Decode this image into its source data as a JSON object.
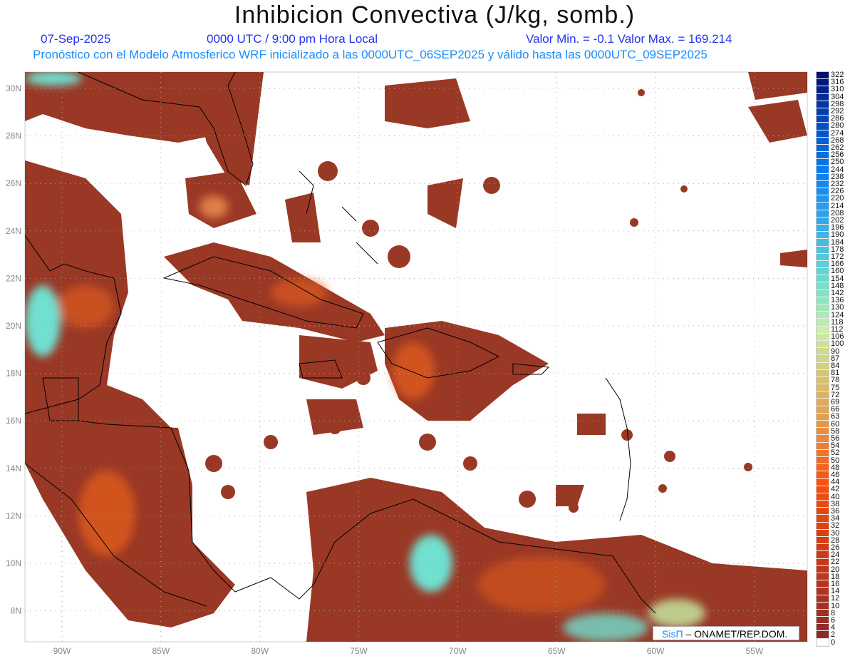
{
  "header": {
    "title": "Inhibicion Convectiva (J/kg, somb.)",
    "date": "07-Sep-2025",
    "time": "0000 UTC / 9:00 pm Hora Local",
    "minmax": "Valor Min. = -0.1  Valor Max. = 169.214",
    "forecast": "Pronóstico con el Modelo Atmosferico WRF inicializado a las 0000UTC_06SEP2025 y válido hasta las  0000UTC_09SEP2025"
  },
  "axes": {
    "lon_labels": [
      "90W",
      "85W",
      "80W",
      "75W",
      "70W",
      "65W",
      "60W",
      "55W"
    ],
    "lat_labels": [
      "30N",
      "28N",
      "26N",
      "24N",
      "22N",
      "20N",
      "18N",
      "16N",
      "14N",
      "12N",
      "10N",
      "8N"
    ]
  },
  "colorbar": {
    "labels": [
      "322",
      "316",
      "310",
      "304",
      "298",
      "292",
      "286",
      "280",
      "274",
      "268",
      "262",
      "256",
      "250",
      "244",
      "238",
      "232",
      "226",
      "220",
      "214",
      "208",
      "202",
      "196",
      "190",
      "184",
      "178",
      "172",
      "166",
      "160",
      "154",
      "148",
      "142",
      "136",
      "130",
      "124",
      "118",
      "112",
      "106",
      "100",
      "90",
      "87",
      "84",
      "81",
      "78",
      "75",
      "72",
      "69",
      "66",
      "63",
      "60",
      "58",
      "56",
      "54",
      "52",
      "50",
      "48",
      "46",
      "44",
      "42",
      "40",
      "38",
      "36",
      "34",
      "32",
      "30",
      "28",
      "26",
      "24",
      "22",
      "20",
      "18",
      "16",
      "14",
      "12",
      "10",
      "8",
      "6",
      "4",
      "2",
      "0"
    ],
    "stops": [
      "#001070",
      "#0050c8",
      "#0a84f5",
      "#3aaee6",
      "#66dcd0",
      "#c8f0a8",
      "#d8c070",
      "#e89040",
      "#f85010",
      "#d84010",
      "#b83420",
      "#8c2a28",
      "#ffffff"
    ]
  },
  "logo": {
    "brand": "SisΠ",
    "text": " – ONAMET/REP.DOM."
  },
  "colors": {
    "cin_low": "#9a3826",
    "cin_mid": "#e8601a",
    "cin_high": "#70e0d0"
  }
}
